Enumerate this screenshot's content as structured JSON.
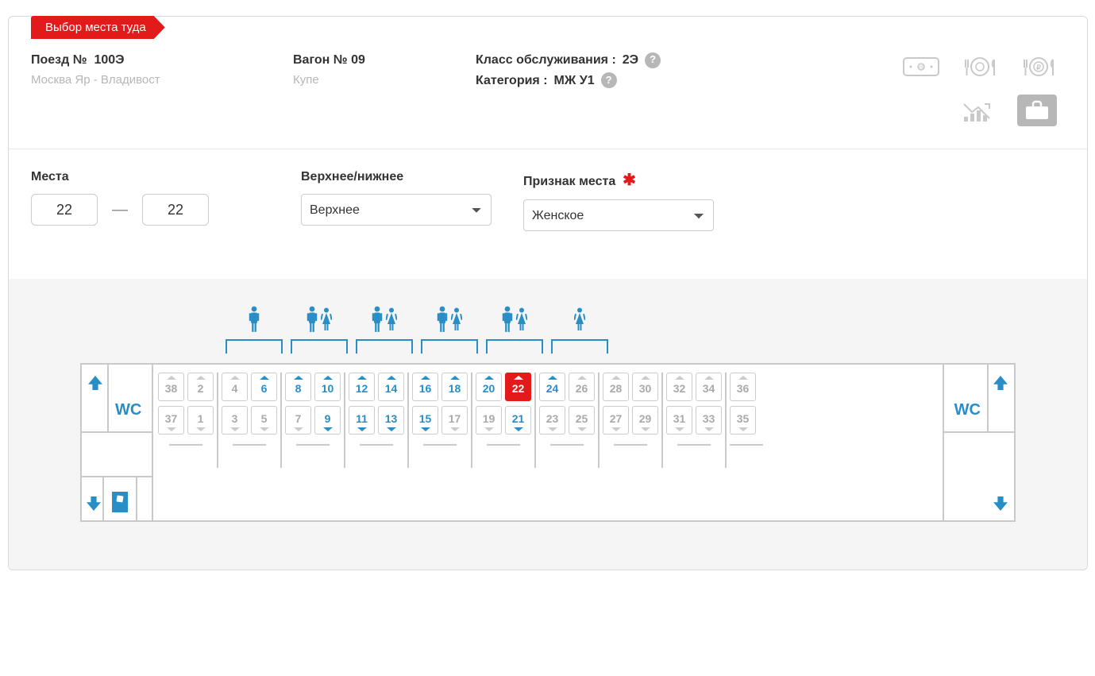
{
  "ribbon": "Выбор места туда",
  "train": {
    "label": "Поезд №",
    "number": "100Э",
    "route": "Москва Яр - Владивост"
  },
  "car": {
    "label": "Вагон № 09",
    "type": "Купе"
  },
  "service": {
    "class_k": "Класс обслуживания :",
    "class_v": "2Э",
    "cat_k": "Категория :",
    "cat_v": "МЖ У1"
  },
  "filters": {
    "seats_label": "Места",
    "seat_from": "22",
    "seat_to": "22",
    "berth_label": "Верхнее/нижнее",
    "berth_value": "Верхнее",
    "gender_label": "Признак места",
    "gender_value": "Женское"
  },
  "wc": "WC",
  "legend_types": [
    "M",
    "MF",
    "MF",
    "MF",
    "MF",
    "F"
  ],
  "compartments": [
    {
      "seats": [
        {
          "n": 38,
          "pos": "upper",
          "state": "na"
        },
        {
          "n": 2,
          "pos": "upper",
          "state": "na"
        },
        {
          "n": 37,
          "pos": "lower",
          "state": "na"
        },
        {
          "n": 1,
          "pos": "lower",
          "state": "na"
        }
      ],
      "legend": null
    },
    {
      "seats": [
        {
          "n": 4,
          "pos": "upper",
          "state": "na"
        },
        {
          "n": 6,
          "pos": "upper",
          "state": "avail"
        },
        {
          "n": 3,
          "pos": "lower",
          "state": "na"
        },
        {
          "n": 5,
          "pos": "lower",
          "state": "na"
        }
      ],
      "legend": "M"
    },
    {
      "seats": [
        {
          "n": 8,
          "pos": "upper",
          "state": "avail"
        },
        {
          "n": 10,
          "pos": "upper",
          "state": "avail"
        },
        {
          "n": 7,
          "pos": "lower",
          "state": "na"
        },
        {
          "n": 9,
          "pos": "lower",
          "state": "avail"
        }
      ],
      "legend": "MF"
    },
    {
      "seats": [
        {
          "n": 12,
          "pos": "upper",
          "state": "avail"
        },
        {
          "n": 14,
          "pos": "upper",
          "state": "avail"
        },
        {
          "n": 11,
          "pos": "lower",
          "state": "avail"
        },
        {
          "n": 13,
          "pos": "lower",
          "state": "avail"
        }
      ],
      "legend": "MF"
    },
    {
      "seats": [
        {
          "n": 16,
          "pos": "upper",
          "state": "avail"
        },
        {
          "n": 18,
          "pos": "upper",
          "state": "avail"
        },
        {
          "n": 15,
          "pos": "lower",
          "state": "avail"
        },
        {
          "n": 17,
          "pos": "lower",
          "state": "na"
        }
      ],
      "legend": "MF"
    },
    {
      "seats": [
        {
          "n": 20,
          "pos": "upper",
          "state": "avail"
        },
        {
          "n": 22,
          "pos": "upper",
          "state": "selected"
        },
        {
          "n": 19,
          "pos": "lower",
          "state": "na"
        },
        {
          "n": 21,
          "pos": "lower",
          "state": "avail"
        }
      ],
      "legend": "MF"
    },
    {
      "seats": [
        {
          "n": 24,
          "pos": "upper",
          "state": "avail"
        },
        {
          "n": 26,
          "pos": "upper",
          "state": "na"
        },
        {
          "n": 23,
          "pos": "lower",
          "state": "na"
        },
        {
          "n": 25,
          "pos": "lower",
          "state": "na"
        }
      ],
      "legend": "F"
    },
    {
      "seats": [
        {
          "n": 28,
          "pos": "upper",
          "state": "na"
        },
        {
          "n": 30,
          "pos": "upper",
          "state": "na"
        },
        {
          "n": 27,
          "pos": "lower",
          "state": "na"
        },
        {
          "n": 29,
          "pos": "lower",
          "state": "na"
        }
      ],
      "legend": null
    },
    {
      "seats": [
        {
          "n": 32,
          "pos": "upper",
          "state": "na"
        },
        {
          "n": 34,
          "pos": "upper",
          "state": "na"
        },
        {
          "n": 31,
          "pos": "lower",
          "state": "na"
        },
        {
          "n": 33,
          "pos": "lower",
          "state": "na"
        }
      ],
      "legend": null
    },
    {
      "seats": [
        {
          "n": 36,
          "pos": "upper",
          "state": "na"
        },
        {
          "n": 35,
          "pos": "lower",
          "state": "na"
        }
      ],
      "legend": null,
      "half": true
    }
  ]
}
